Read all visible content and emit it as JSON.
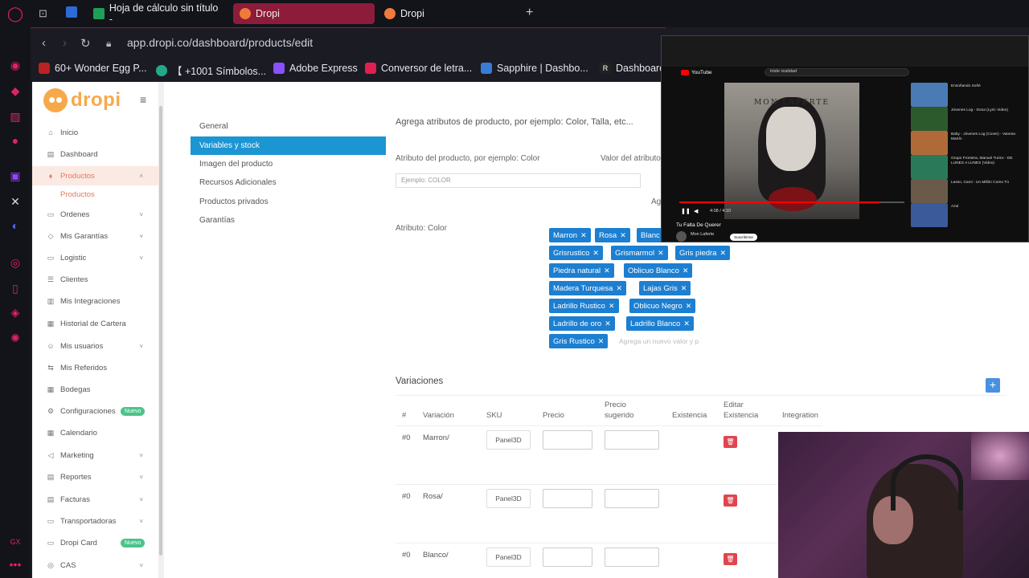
{
  "browser": {
    "tabs": [
      {
        "label": "Hoja de cálculo sin título -",
        "color": "#1e9e57"
      },
      {
        "label": "Dropi",
        "color": "#f07a3a",
        "active": true
      },
      {
        "label": "Dropi",
        "color": "#f07a3a"
      }
    ],
    "new_tab": "+",
    "url": "app.dropi.co/dashboard/products/edit",
    "bookmarks": [
      {
        "label": "60+ Wonder Egg P...",
        "color": "#b22"
      },
      {
        "label": "【 +1001 Símbolos...",
        "color": "#2a8"
      },
      {
        "label": "Adobe Express",
        "color": "#8a4fff"
      },
      {
        "label": "Conversor de letra...",
        "color": "#e02050"
      },
      {
        "label": "Sapphire | Dashbo...",
        "color": "#3a7bd5"
      },
      {
        "label": "Dashboard",
        "color": "#222"
      }
    ],
    "accent": "#8d1c3a"
  },
  "app": {
    "logo": "dropi",
    "sidebar": [
      {
        "label": "Inicio",
        "icon": "home-icon",
        "chev": ""
      },
      {
        "label": "Dashboard",
        "icon": "dashboard-icon",
        "chev": ""
      },
      {
        "label": "Productos",
        "icon": "tag-icon",
        "chev": "˄",
        "active": true
      },
      {
        "label": "Productos",
        "sub": true
      },
      {
        "label": "Ordenes",
        "icon": "cart-icon",
        "chev": "˅"
      },
      {
        "label": "Mis Garantías",
        "icon": "shield-icon",
        "chev": "˅"
      },
      {
        "label": "Logistic",
        "icon": "truck-icon",
        "chev": "˅"
      },
      {
        "label": "Clientes",
        "icon": "users-icon",
        "chev": ""
      },
      {
        "label": "Mis Integraciones",
        "icon": "plug-icon",
        "chev": ""
      },
      {
        "label": "Historial de Cartera",
        "icon": "wallet-icon",
        "chev": ""
      },
      {
        "label": "Mis usuarios",
        "icon": "user-icon",
        "chev": "˅"
      },
      {
        "label": "Mis Referidos",
        "icon": "share-icon",
        "chev": ""
      },
      {
        "label": "Bodegas",
        "icon": "warehouse-icon",
        "chev": ""
      },
      {
        "label": "Configuraciones",
        "icon": "gear-icon",
        "badge": "Nuevo"
      },
      {
        "label": "Calendario",
        "icon": "calendar-icon",
        "chev": ""
      },
      {
        "label": "Marketing",
        "icon": "megaphone-icon",
        "chev": "˅"
      },
      {
        "label": "Reportes",
        "icon": "report-icon",
        "chev": "˅"
      },
      {
        "label": "Facturas",
        "icon": "invoice-icon",
        "chev": "˅"
      },
      {
        "label": "Transportadoras",
        "icon": "truck-icon",
        "chev": "˅"
      },
      {
        "label": "Dropi Card",
        "icon": "card-icon",
        "badge": "Nuevo"
      },
      {
        "label": "CAS",
        "icon": "cas-icon",
        "chev": "˅"
      }
    ],
    "subnav": [
      "General",
      "Variables y stock",
      "Imagen del producto",
      "Recursos Adicionales",
      "Productos privados",
      "Garantías"
    ],
    "attributes": {
      "intro": "Agrega atributos de producto, por ejemplo: Color, Talla, etc...",
      "attr_label": "Atributo del producto, por ejemplo: Color",
      "value_label": "Valor del atributo",
      "placeholder": "Ejemplo: COLOR",
      "ag": "Ag",
      "current": "Atributo: Color",
      "chips": [
        "Marron",
        "Rosa",
        "Blanc",
        "Grisrustico",
        "Grismarmol",
        "Gris piedra",
        "Piedra natural",
        "Oblicuo Blanco",
        "Madera Turquesa",
        "Lajas Gris",
        "Ladrillo Rustico",
        "Oblicuo Negro",
        "Ladrillo de oro",
        "Ladrillo Blanco",
        "Gris Rustico"
      ],
      "new_value_placeholder": "Agrega un nuevo valor y p"
    },
    "variations": {
      "title": "Variaciones",
      "add": "+",
      "headers": [
        "#",
        "Variación",
        "SKU",
        "Precio",
        "Precio sugerido",
        "Existencia",
        "Editar Existencia",
        "Integration"
      ],
      "rows": [
        {
          "num": "#0",
          "name": "Marron/",
          "sku": "Panel3D"
        },
        {
          "num": "#0",
          "name": "Rosa/",
          "sku": "Panel3D"
        },
        {
          "num": "#0",
          "name": "Blanco/",
          "sku": "Panel3D"
        }
      ]
    }
  },
  "pip": {
    "site": "YouTube",
    "search": "triste realidad",
    "album": "MON LAFERTE",
    "time": "4:08 / 4:10",
    "progress": 0.89,
    "video_title": "Tu Falta De Querer",
    "channel": "Mon Laferte",
    "subscribe": "Suscribirme",
    "suggestions": [
      {
        "title": "Ensoñando Soñé",
        "color": "#4a7bb5"
      },
      {
        "title": "Jóvenes Log - Dona (Lyric Video)",
        "color": "#2d5a2d"
      },
      {
        "title": "Baby - Jóvenes Log (Cover) - Vanesa Martín",
        "color": "#b06a3a"
      },
      {
        "title": "Grupo Frontera, Manuel Turizo - DE LUNES A LUNES (Video)",
        "color": "#2a7a5a"
      },
      {
        "title": "Lasso, Cami - Un Millón Como Tú",
        "color": "#6a5a4a"
      },
      {
        "title": "Azul",
        "color": "#3a5a9a"
      }
    ]
  }
}
